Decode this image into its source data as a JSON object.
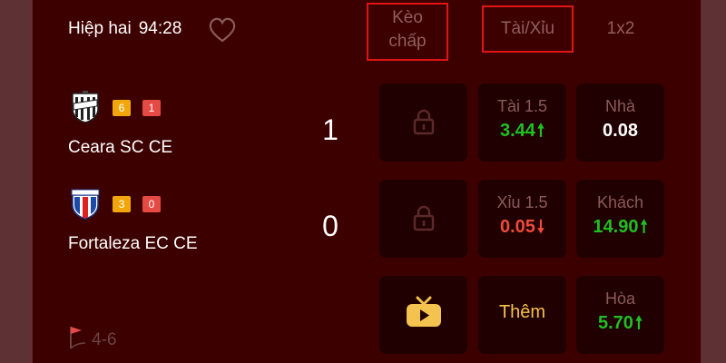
{
  "match": {
    "period": "Hiệp hai",
    "time": "94:28",
    "corners": "4-6"
  },
  "tabs": {
    "handicap": [
      "Kèo",
      "chấp"
    ],
    "over_under": "Tài/Xỉu",
    "x12": "1x2"
  },
  "teams": [
    {
      "name": "Ceara SC CE",
      "yellow": "6",
      "red": "1",
      "score": "1",
      "logo_icon": "ceara-logo"
    },
    {
      "name": "Fortaleza EC CE",
      "yellow": "3",
      "red": "0",
      "score": "0",
      "logo_icon": "fortaleza-logo"
    }
  ],
  "odds": {
    "over": {
      "label": "Tài 1.5",
      "value": "3.44",
      "trend": "up"
    },
    "under": {
      "label": "Xỉu 1.5",
      "value": "0.05",
      "trend": "down"
    },
    "home": {
      "label": "Nhà",
      "value": "0.08"
    },
    "away": {
      "label": "Khách",
      "value": "14.90",
      "trend": "up"
    },
    "draw": {
      "label": "Hòa",
      "value": "5.70",
      "trend": "up"
    },
    "more": "Thêm"
  },
  "colors": {
    "panel_bg": "#3d0000",
    "cell_bg": "#200000",
    "up": "#20c020",
    "down": "#ef4a3c",
    "yellow_card": "#f1a60c",
    "red_card": "#e64a45",
    "highlight_border": "#e01414",
    "more_label": "#f4c24e"
  }
}
